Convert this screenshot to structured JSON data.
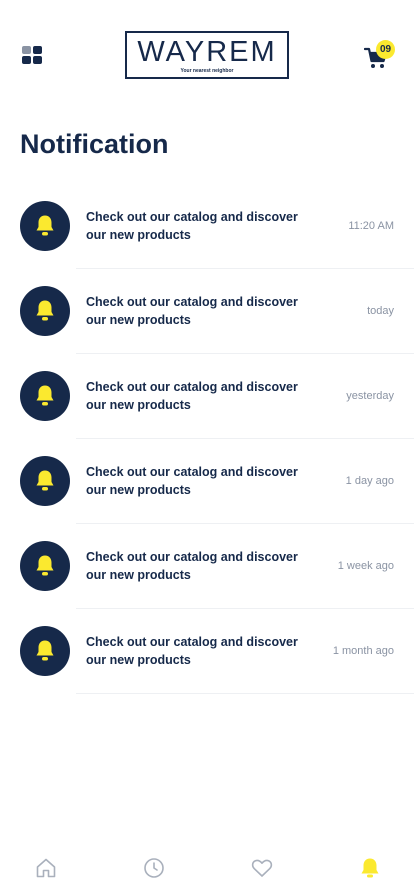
{
  "header": {
    "menu_icon": "grid-menu-icon",
    "logo": {
      "wordmark": "WAYREM",
      "tagline": "Your nearest neighbor"
    },
    "cart": {
      "icon": "cart-icon",
      "badge_count": "09"
    }
  },
  "page": {
    "title": "Notification"
  },
  "notifications": [
    {
      "icon": "bell-icon",
      "message": "Check out our catalog and discover our new products",
      "time": "11:20 AM"
    },
    {
      "icon": "bell-icon",
      "message": "Check out our catalog and discover our new products",
      "time": "today"
    },
    {
      "icon": "bell-icon",
      "message": "Check out our catalog and discover our new products",
      "time": "yesterday"
    },
    {
      "icon": "bell-icon",
      "message": "Check out our catalog and discover our new products",
      "time": "1 day ago"
    },
    {
      "icon": "bell-icon",
      "message": "Check out our catalog and discover our new products",
      "time": "1 week ago"
    },
    {
      "icon": "bell-icon",
      "message": "Check out our catalog and discover our new products",
      "time": "1 month ago"
    }
  ],
  "bottom_nav": {
    "items": [
      {
        "icon": "home-icon",
        "active": false
      },
      {
        "icon": "clock-icon",
        "active": false
      },
      {
        "icon": "heart-icon",
        "active": false
      },
      {
        "icon": "bell-icon",
        "active": true
      }
    ]
  },
  "colors": {
    "primary": "#16294a",
    "accent": "#fbe92f",
    "muted": "#8a93a3",
    "divider": "#eef0f3",
    "background": "#ffffff"
  }
}
